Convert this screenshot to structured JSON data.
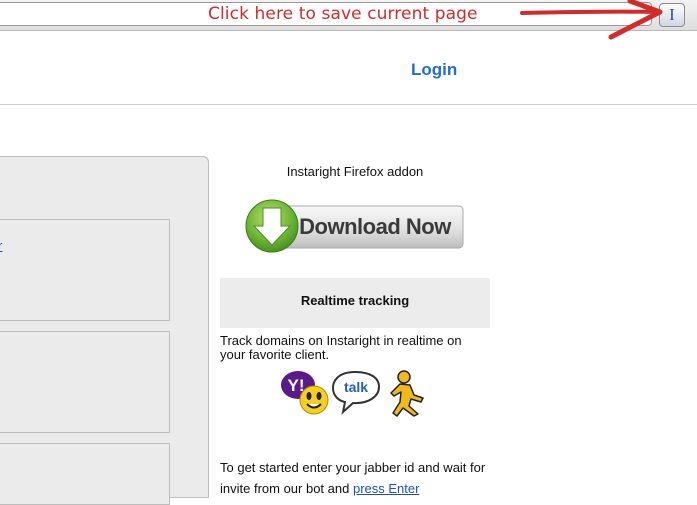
{
  "browser": {
    "addon_button_label": "I",
    "annotation": "Click here to save current page"
  },
  "header": {
    "login_link": "Login"
  },
  "left_panel": {
    "link_fragment": "r"
  },
  "right": {
    "addon_title": "Instaright Firefox addon",
    "download_label": "Download Now",
    "realtime_title": "Realtime tracking",
    "realtime_desc": "Track domains on Instaright in realtime on your favorite client.",
    "clients": [
      {
        "name": "yahoo-messenger-icon",
        "label": "Y!"
      },
      {
        "name": "google-talk-icon",
        "label": "talk"
      },
      {
        "name": "aim-running-man-icon",
        "label": ""
      }
    ],
    "get_started_text": "To get started enter your jabber id and wait for invite from our bot and ",
    "get_started_link": "press Enter"
  },
  "colors": {
    "annotation_red": "#d42a2a",
    "link_blue": "#1e6fcf",
    "download_green": "#6fb536"
  }
}
